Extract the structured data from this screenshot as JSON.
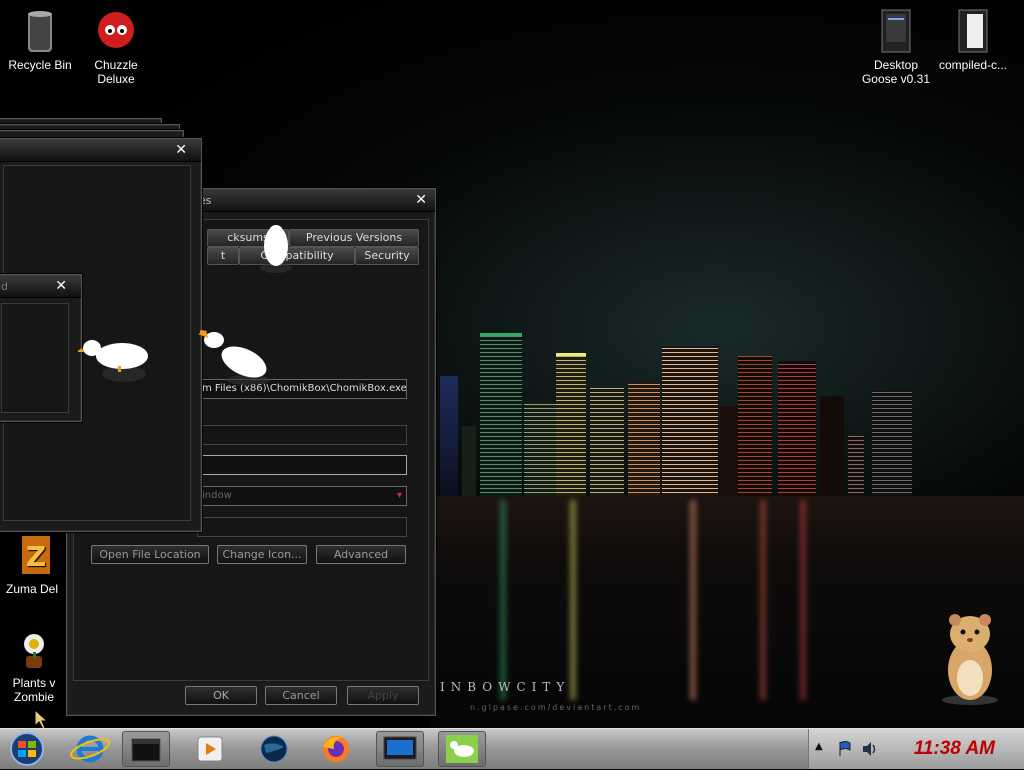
{
  "desktop": {
    "icons": [
      {
        "label": "Recycle Bin",
        "icon": "recycle-bin-icon"
      },
      {
        "label": "Chuzzle",
        "label2": "Deluxe",
        "icon": "chuzzle-icon"
      },
      {
        "label": "Desktop",
        "label2": "Goose v0.31",
        "icon": "folder-icon"
      },
      {
        "label": "compiled-c...",
        "icon": "folder-icon"
      },
      {
        "label": "Zuma Del",
        "icon": "zuma-icon"
      },
      {
        "label": "Plants v",
        "label2": "Zombie",
        "icon": "plants-vs-zombies-icon"
      }
    ]
  },
  "wallpaper": {
    "caption": "INBOWCITY",
    "subcaption": "n.glpase.com/deviantart.com"
  },
  "properties_dialog": {
    "title": "es",
    "tabs_row1": [
      "cksums",
      "Previous Versions"
    ],
    "tabs_row2": [
      "t",
      "Compatibility",
      "Security"
    ],
    "target_value": "m Files (x86)\\ChomikBox\\ChomikBox.exe\"",
    "run_value": "indow",
    "buttons": {
      "open_file_location": "Open File Location",
      "change_icon": "Change Icon...",
      "advanced": "Advanced"
    },
    "footer": {
      "ok": "OK",
      "cancel": "Cancel",
      "apply": "Apply"
    }
  },
  "small_window": {
    "title": "d"
  },
  "taskbar": {
    "clock": "11:38 AM",
    "items": [
      "internet-explorer-icon",
      "folder-icon",
      "media-player-icon",
      "globe-icon",
      "firefox-icon",
      "monitor-icon",
      "goose-app-icon"
    ]
  },
  "colors": {
    "clock": "#c00000",
    "window_bg": "#1b1b1b",
    "taskbar": "#9a9a9a"
  }
}
